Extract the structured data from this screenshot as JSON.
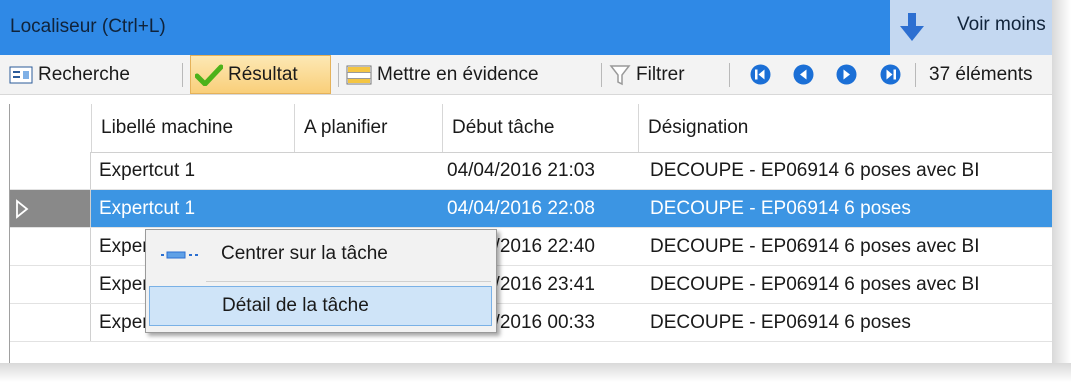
{
  "title_bar": {
    "title": "Localiseur (Ctrl+L)",
    "view_less_label": "Voir moins"
  },
  "toolbar": {
    "search_label": "Recherche",
    "result_label": "Résultat",
    "highlight_label": "Mettre en évidence",
    "filter_label": "Filtrer",
    "count_label": "37 éléments",
    "icons": [
      "search-icon",
      "check-icon",
      "highlight-icon",
      "filter-icon",
      "first-icon",
      "previous-icon",
      "next-icon",
      "last-icon"
    ]
  },
  "grid": {
    "columns": [
      "Libellé machine",
      "A planifier",
      "Début tâche",
      "Désignation"
    ],
    "rows": [
      {
        "machine": "Expertcut 1",
        "planifier": "",
        "debut": "04/04/2016 21:03",
        "designation": "DECOUPE - EP06914 6 poses avec BI"
      },
      {
        "machine": "Expertcut 1",
        "planifier": "",
        "debut": "04/04/2016 22:08",
        "designation": "DECOUPE - EP06914 6 poses",
        "selected": true
      },
      {
        "machine": "Expertcut 1",
        "planifier": "",
        "debut": "04/04/2016 22:40",
        "designation": "DECOUPE - EP06914 6 poses avec BI"
      },
      {
        "machine": "Expertcut 1",
        "planifier": "",
        "debut": "04/04/2016 23:41",
        "designation": "DECOUPE - EP06914 6 poses avec BI"
      },
      {
        "machine": "Expertcut 1",
        "planifier": "",
        "debut": "05/04/2016 00:33",
        "designation": "DECOUPE - EP06914 6 poses"
      }
    ]
  },
  "context_menu": {
    "items": [
      {
        "label": "Centrer sur la tâche",
        "icon": "center-on-task-icon"
      },
      {
        "label": "Détail de la tâche",
        "highlighted": true
      }
    ]
  },
  "colors": {
    "title_blue": "#2f89e6",
    "selection_blue": "#3c95e3",
    "menu_highlight": "#cfe4f8",
    "accent_orange": "#f9cf7a"
  }
}
